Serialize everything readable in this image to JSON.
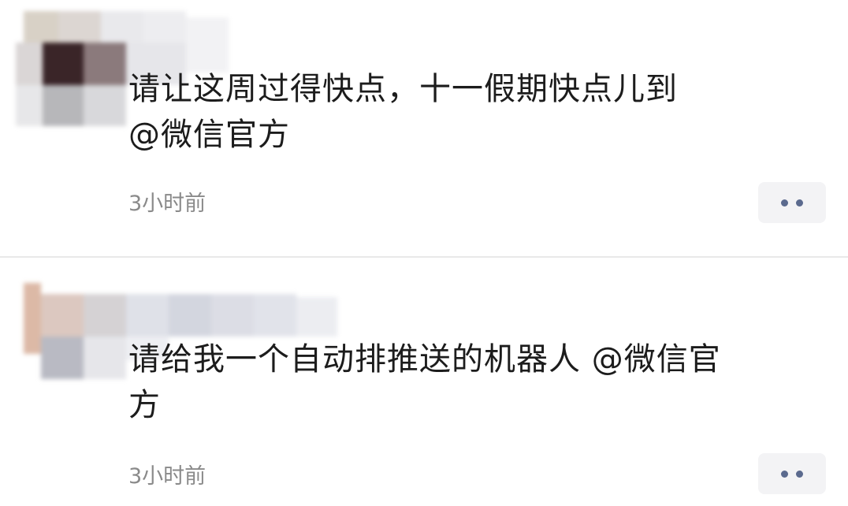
{
  "comments": [
    {
      "text_line1": "请让这周过得快点，十一假期快点儿到",
      "text_line2": "@微信官方",
      "time": "3小时前",
      "more_icon": "more-dots-icon"
    },
    {
      "text_line1": "请给我一个自动排推送的机器人 @微信官",
      "text_line2": "方",
      "time": "3小时前",
      "more_icon": "more-dots-icon"
    }
  ],
  "colors": {
    "text": "#1c1c1c",
    "timestamp": "#8a8a8a",
    "more_button_bg": "#f3f3f5",
    "more_dots": "#5b6a8e"
  }
}
